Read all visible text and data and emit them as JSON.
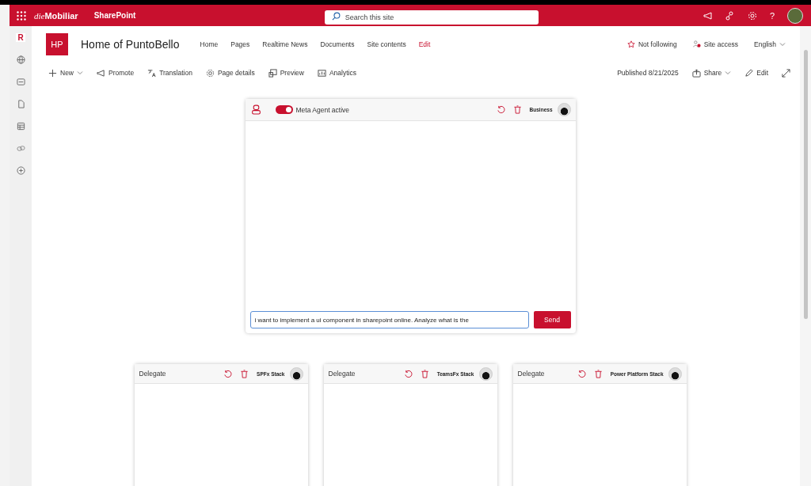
{
  "suite_bar": {
    "brand_prefix": "die",
    "brand_name": "Mobiliar",
    "app": "SharePoint",
    "search": {
      "placeholder": "Search this site"
    },
    "help": "?"
  },
  "sidebar": {
    "logo": "R"
  },
  "site_header": {
    "logo": "HP",
    "title": "Home of PuntoBello",
    "nav": [
      {
        "label": "Home",
        "kind": "link"
      },
      {
        "label": "Pages",
        "kind": "link"
      },
      {
        "label": "Realtime News",
        "kind": "link"
      },
      {
        "label": "Documents",
        "kind": "link"
      },
      {
        "label": "Site contents",
        "kind": "link"
      },
      {
        "label": "Edit",
        "kind": "edit"
      }
    ],
    "follow": "Not following",
    "site_access": "Site access",
    "language": "English"
  },
  "command_bar": {
    "left": [
      {
        "label": "New",
        "dropdown": true
      },
      {
        "label": "Promote",
        "dropdown": false
      },
      {
        "label": "Translation",
        "dropdown": false
      },
      {
        "label": "Page details",
        "dropdown": false
      },
      {
        "label": "Preview",
        "dropdown": false
      },
      {
        "label": "Analytics",
        "dropdown": false
      }
    ],
    "published": "Published 8/21/2025",
    "share": "Share",
    "edit": "Edit"
  },
  "agent": {
    "toggle_on": true,
    "toggle_label": "Meta Agent active",
    "persona": "Business",
    "input_value": "i want to implement a ui component in sharepoint online. Analyze what is the",
    "send": "Send"
  },
  "delegates": [
    {
      "title": "Delegate",
      "stack": "SPFx Stack"
    },
    {
      "title": "Delegate",
      "stack": "TeamsFx Stack"
    },
    {
      "title": "Delegate",
      "stack": "Power Platform Stack"
    }
  ]
}
